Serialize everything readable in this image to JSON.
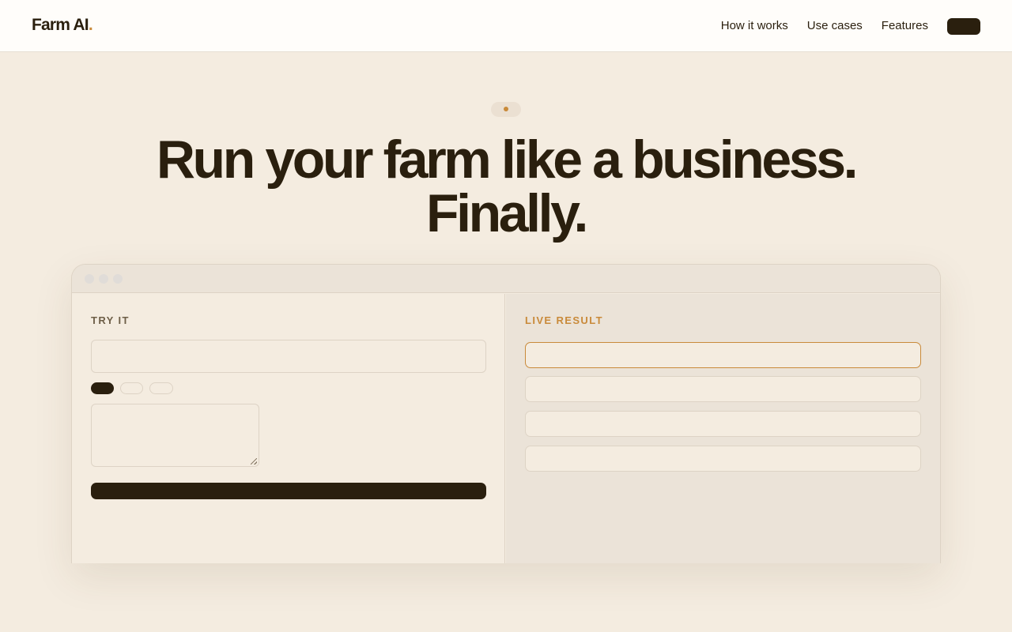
{
  "brand": {
    "name": "Farm AI",
    "accent_dot": "."
  },
  "nav": {
    "links": [
      "How it works",
      "Use cases",
      "Features"
    ],
    "cta_label": ""
  },
  "hero": {
    "badge_label": "",
    "headline": "Run your farm like a business. Finally."
  },
  "demo": {
    "try_label": "TRY IT",
    "input_placeholder": "",
    "chips": [
      "",
      "",
      ""
    ],
    "textarea_placeholder": "",
    "submit_label": "",
    "result_label": "LIVE RESULT",
    "results": [
      "",
      "",
      "",
      ""
    ]
  },
  "colors": {
    "background": "#f4ece0",
    "ink": "#2a1f0e",
    "accent": "#c98a3a",
    "panel": "#ebe3d8"
  }
}
